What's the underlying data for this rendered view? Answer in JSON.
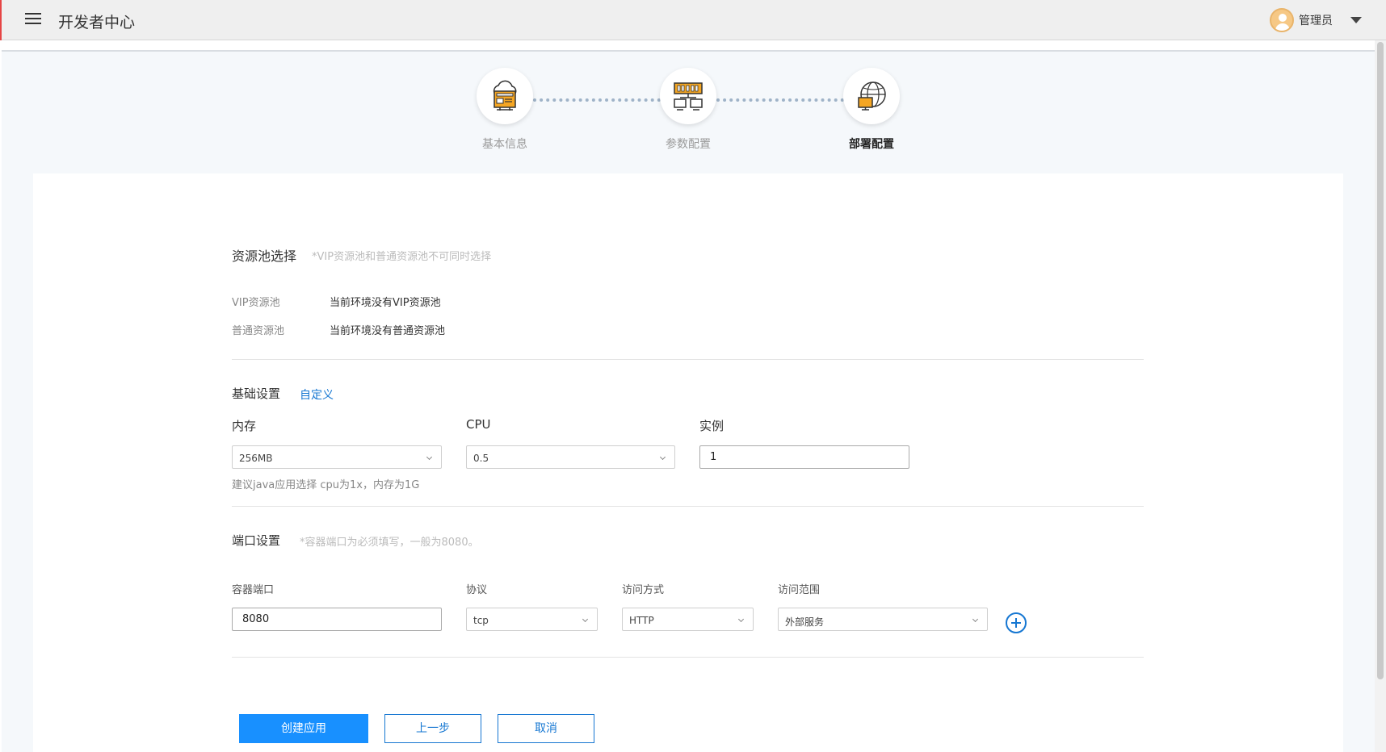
{
  "header": {
    "app_title": "开发者中心",
    "user_name": "管理员"
  },
  "stepper": {
    "steps": [
      {
        "label": "基本信息",
        "icon": "cloud-server-icon",
        "state": "done"
      },
      {
        "label": "参数配置",
        "icon": "network-config-icon",
        "state": "done"
      },
      {
        "label": "部署配置",
        "icon": "globe-deploy-icon",
        "state": "active"
      }
    ]
  },
  "resource_pool": {
    "title": "资源池选择",
    "hint": "*VIP资源池和普通资源池不可同时选择",
    "vip_label": "VIP资源池",
    "vip_value": "当前环境没有VIP资源池",
    "normal_label": "普通资源池",
    "normal_value": "当前环境没有普通资源池"
  },
  "basic_settings": {
    "title": "基础设置",
    "custom_link": "自定义",
    "memory_label": "内存",
    "memory_value": "256MB",
    "cpu_label": "CPU",
    "cpu_value": "0.5",
    "instance_label": "实例",
    "instance_value": "1",
    "suggestion": "建议java应用选择 cpu为1x，内存为1G"
  },
  "port_settings": {
    "title": "端口设置",
    "hint": "*容器端口为必须填写，一般为8080。",
    "container_port_label": "容器端口",
    "container_port_value": "8080",
    "protocol_label": "协议",
    "protocol_value": "tcp",
    "access_method_label": "访问方式",
    "access_method_value": "HTTP",
    "access_scope_label": "访问范围",
    "access_scope_value": "外部服务"
  },
  "actions": {
    "create_label": "创建应用",
    "prev_label": "上一步",
    "cancel_label": "取消"
  },
  "colors": {
    "primary": "#1890ff",
    "link": "#1677d2",
    "step_icon": "#f5a623"
  }
}
